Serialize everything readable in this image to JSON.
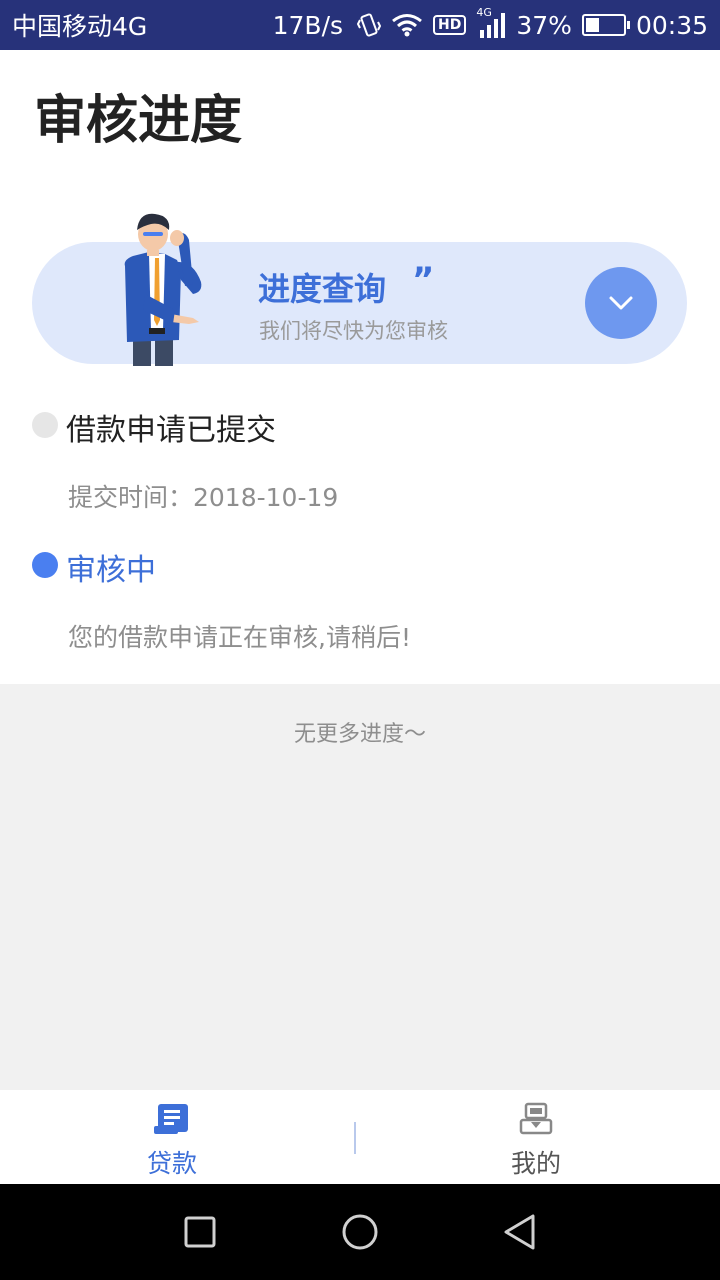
{
  "status_bar": {
    "carrier": "中国移动4G",
    "speed": "17B/s",
    "hd": "HD",
    "network": "4G",
    "battery_text": "37%",
    "battery_level": 0.37,
    "time": "00:35"
  },
  "page": {
    "title": "审核进度"
  },
  "banner": {
    "title": "进度查询",
    "quote": "”",
    "subtitle": "我们将尽快为您审核",
    "expand_icon": "chevron-down-icon"
  },
  "timeline": [
    {
      "title": "借款申请已提交",
      "detail": "提交时间：2018-10-19",
      "state": "done"
    },
    {
      "title": "审核中",
      "detail": "您的借款申请正在审核,请稍后!",
      "state": "current"
    }
  ],
  "footer_note": "无更多进度～",
  "tabs": [
    {
      "label": "贷款",
      "icon": "loan-document-icon",
      "active": true
    },
    {
      "label": "我的",
      "icon": "profile-icon",
      "active": false
    }
  ],
  "colors": {
    "accent": "#3d6fd8",
    "status_bar": "#27327a",
    "banner_bg": "#dfe8fb"
  }
}
